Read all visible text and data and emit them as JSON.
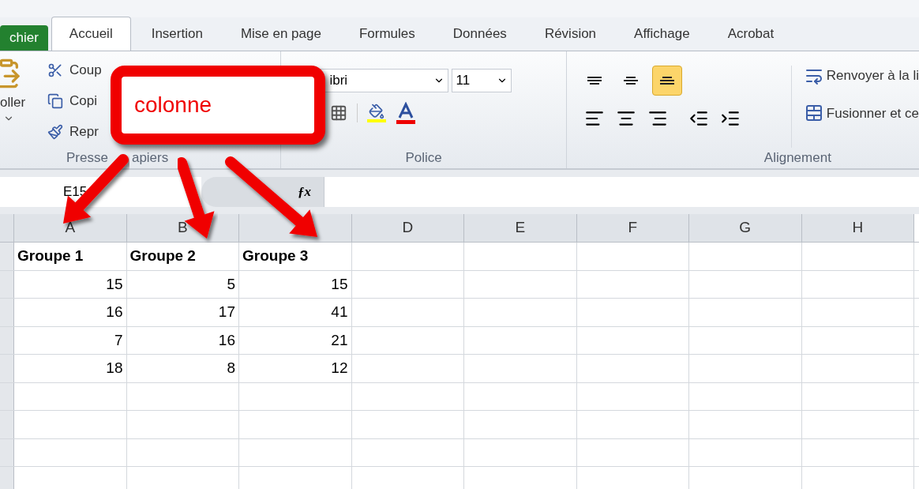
{
  "tabs": [
    {
      "label": "chier",
      "kind": "file",
      "selected": false
    },
    {
      "label": "Accueil",
      "kind": "tab",
      "selected": true
    },
    {
      "label": "Insertion",
      "kind": "tab",
      "selected": false
    },
    {
      "label": "Mise en page",
      "kind": "tab",
      "selected": false
    },
    {
      "label": "Formules",
      "kind": "tab",
      "selected": false
    },
    {
      "label": "Données",
      "kind": "tab",
      "selected": false
    },
    {
      "label": "Révision",
      "kind": "tab",
      "selected": false
    },
    {
      "label": "Affichage",
      "kind": "tab",
      "selected": false
    },
    {
      "label": "Acrobat",
      "kind": "tab",
      "selected": false
    }
  ],
  "clipboard": {
    "paste_label": "oller",
    "commands": [
      "Coup",
      "Copi",
      "Repr"
    ],
    "group_label_parts": [
      "Presse",
      "apiers"
    ]
  },
  "font": {
    "name": "ibri",
    "size": "11",
    "group_label": "Police"
  },
  "alignment": {
    "vertical": [
      {
        "kind": "top",
        "selected": false
      },
      {
        "kind": "middle",
        "selected": false
      },
      {
        "kind": "bottom",
        "selected": true
      }
    ],
    "commands": [
      "Renvoyer à la li",
      "Fusionner et ce"
    ],
    "group_label": "Alignement"
  },
  "formula_bar": {
    "name_box": "E15",
    "function_label": "ƒx"
  },
  "columns": [
    {
      "label": "A"
    },
    {
      "label": "B"
    },
    {},
    {
      "label": "D"
    },
    {
      "label": "E"
    },
    {
      "label": "F"
    },
    {
      "label": "G"
    },
    {
      "label": "H"
    }
  ],
  "rows": [
    {
      "cells": [
        {
          "text": "Groupe 1",
          "kind": "header"
        },
        {
          "text": "Groupe 2",
          "kind": "header"
        },
        {
          "text": "Groupe 3",
          "kind": "header"
        }
      ]
    },
    {
      "cells": [
        {
          "text": "15",
          "kind": "number"
        },
        {
          "text": "5",
          "kind": "number"
        },
        {
          "text": "15",
          "kind": "number"
        }
      ]
    },
    {
      "cells": [
        {
          "text": "16",
          "kind": "number"
        },
        {
          "text": "17",
          "kind": "number"
        },
        {
          "text": "41",
          "kind": "number"
        }
      ]
    },
    {
      "cells": [
        {
          "text": "7",
          "kind": "number"
        },
        {
          "text": "16",
          "kind": "number"
        },
        {
          "text": "21",
          "kind": "number"
        }
      ]
    },
    {
      "cells": [
        {
          "text": "18",
          "kind": "number"
        },
        {
          "text": "8",
          "kind": "number"
        },
        {
          "text": "12",
          "kind": "number"
        }
      ]
    },
    {
      "cells": []
    },
    {
      "cells": []
    },
    {
      "cells": []
    },
    {
      "cells": []
    }
  ],
  "callout": {
    "text": "colonne"
  }
}
